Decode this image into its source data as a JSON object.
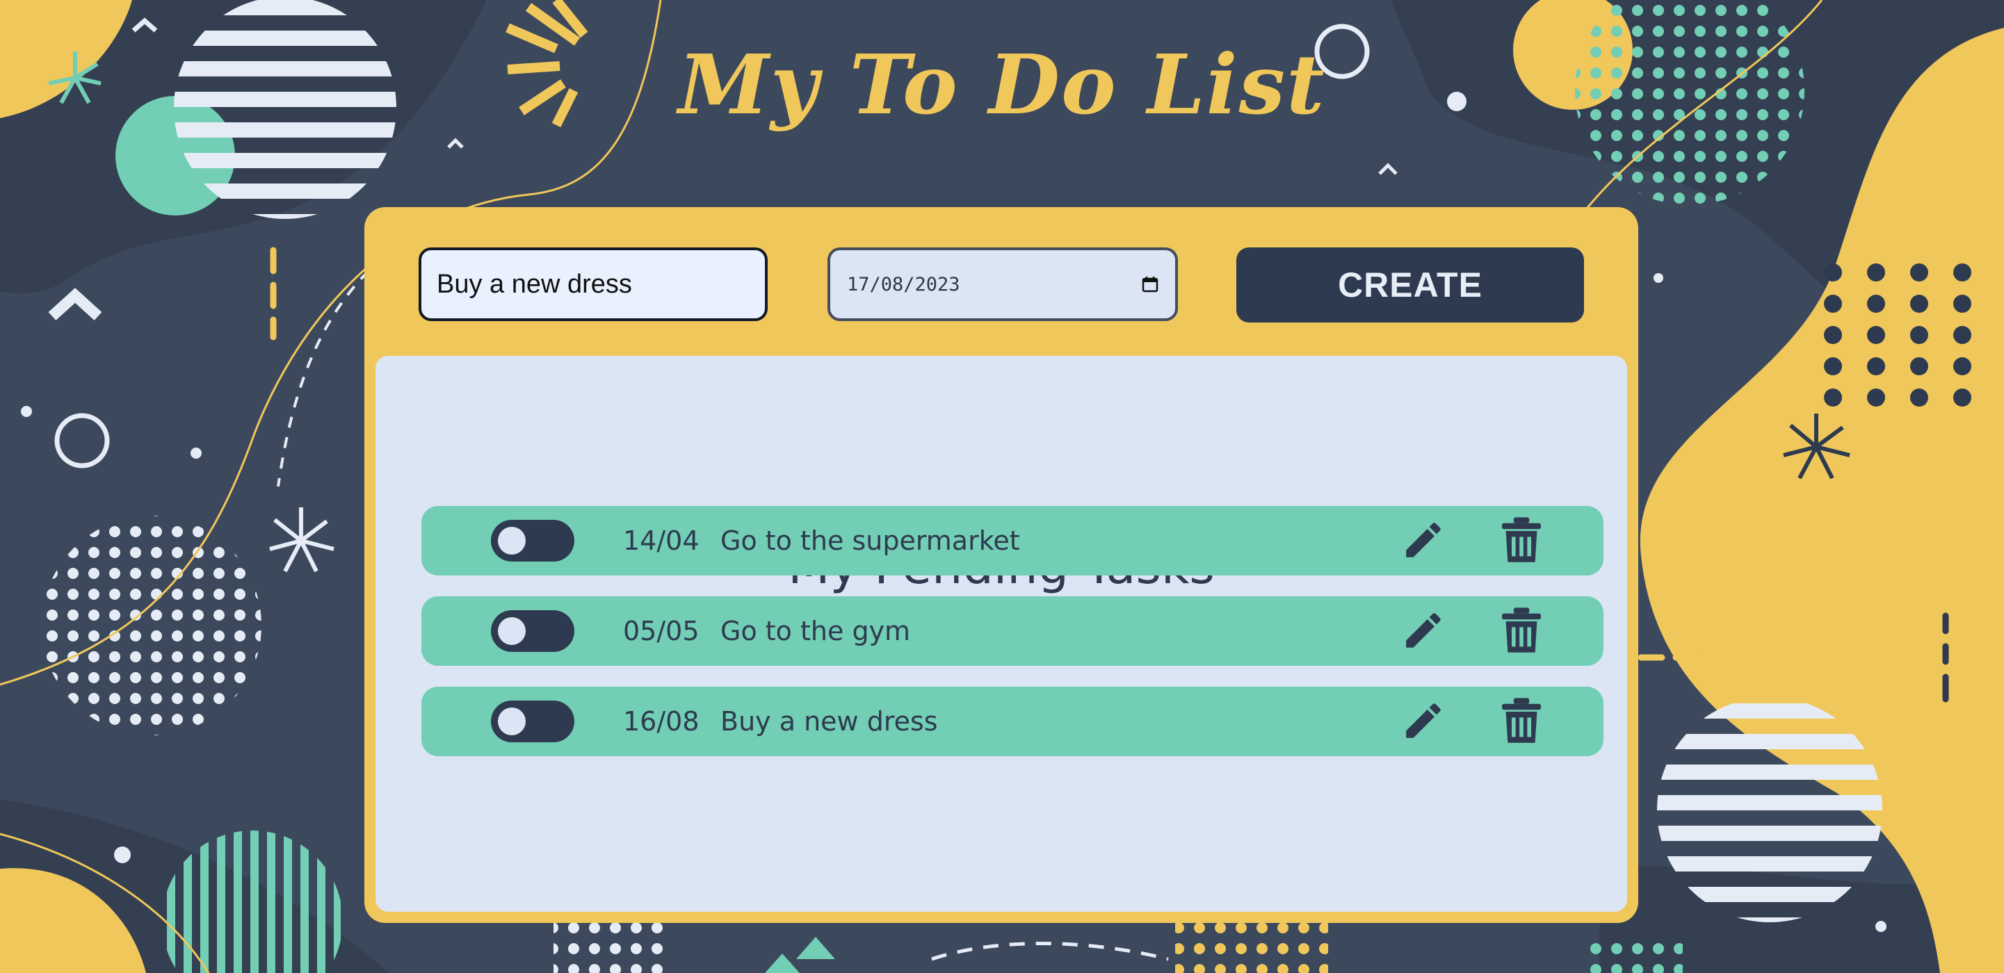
{
  "app": {
    "title": "My To Do List"
  },
  "form": {
    "task_value": "Buy a new dress",
    "date_value": "17/08/2023",
    "create_label": "CREATE"
  },
  "pending": {
    "title": "My Pending Tasks",
    "tasks": [
      {
        "date": "14/04",
        "text": "Go to the supermarket",
        "done": false
      },
      {
        "date": "05/05",
        "text": "Go to the gym",
        "done": false
      },
      {
        "date": "16/08",
        "text": "Buy a new dress",
        "done": false
      }
    ]
  },
  "icons": {
    "toggle": "toggle-switch-icon",
    "edit": "pencil-icon",
    "delete": "trash-icon",
    "calendar": "calendar-icon"
  },
  "colors": {
    "background": "#3c485c",
    "accent_yellow": "#f0c75a",
    "accent_teal": "#72ceb4",
    "panel": "#dbe5f4",
    "dark": "#2e3a4f"
  }
}
